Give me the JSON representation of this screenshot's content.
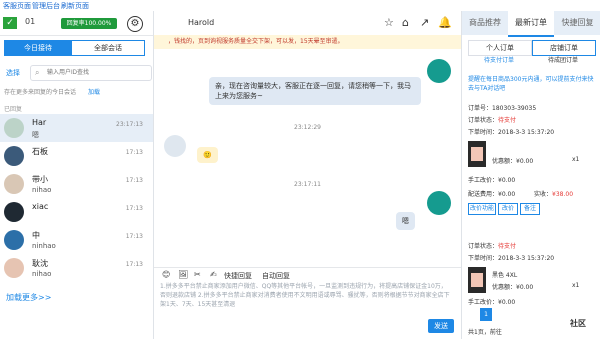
{
  "top_links": [
    "客服页面",
    "管理后台",
    "刷新页面"
  ],
  "left": {
    "status_icon": "check-icon",
    "account_label": "01",
    "online_label": "回复率100.00%",
    "tabs": [
      "今日接待",
      "全部会话"
    ],
    "filter_label": "选择",
    "search_placeholder": "输入用户ID查找",
    "hint_text": "存在更多来回复的今日会话",
    "load_link": "加载",
    "recent_label": "已回复",
    "conversations": [
      {
        "name": "Har",
        "msg": "嗯",
        "time": "23:17:13"
      },
      {
        "name": "石板",
        "msg": "",
        "time": "17:13"
      },
      {
        "name": "带小",
        "msg": "nihao",
        "time": "17:13"
      },
      {
        "name": "xiac",
        "msg": "",
        "time": "17:13"
      },
      {
        "name": "中",
        "msg": "ninhao",
        "time": "17:13"
      },
      {
        "name": "耿沈",
        "msg": "nihao",
        "time": "17:13"
      }
    ],
    "more_link": "加载更多>>"
  },
  "chat": {
    "title": "Harold",
    "header_icons": [
      "star-icon",
      "home-icon",
      "share-icon",
      "bell-icon"
    ],
    "notice": "，钱找的，页到询视服务质量全交下架，可以发，15天晕至审遣。",
    "messages": [
      {
        "side": "right",
        "text": "亲，现在咨询量较大，客服正在逐一回复，请您稍等一下，我马上来为您服务~"
      },
      {
        "time": "23:12:29"
      },
      {
        "side": "left",
        "text": "🙂"
      },
      {
        "time": "23:17:11"
      },
      {
        "side": "right",
        "text": "嗯"
      }
    ],
    "toolbar": [
      "😊",
      "🖼",
      "✂",
      "✍"
    ],
    "quick_reply": "快捷回复",
    "auto_reply": "自动回复",
    "input_text": "1.拼多多平台禁止商家添加用户微信、QQ等其他平台帐号，一旦监测到违规行为，将提高店铺保证金10万，否则退款店铺 2.拼多多平台禁止商家对消费者使用不文明用语或辱骂、骚扰等，否则将根据节节对商家全店下架1天、7天、15天甚至清退",
    "send_label": "发送"
  },
  "right": {
    "tabs": [
      "商品推荐",
      "最新订单",
      "快捷回复"
    ],
    "sub_tabs": [
      "个人订单",
      "店铺订单"
    ],
    "sub_sub": [
      "待支付订单",
      "待成团订单"
    ],
    "notice": "提醒在每日商品300元内通，可以提前支付来快去与TA对话吧",
    "orders": [
      {
        "order_no": "订单号：180303-39035",
        "status_label": "订单状态：",
        "status_value": "待支付",
        "time_label": "下单时间：",
        "time_value": "2018-3-3 15:37:20",
        "discount_label": "优惠额：",
        "discount_value": "¥0.00",
        "count": "x1",
        "manual_label": "手工改价：",
        "manual_value": "¥0.00",
        "ship_label": "配送费用：",
        "ship_value": "¥0.00",
        "paid_label": "实收：",
        "paid_value": "¥38.00",
        "buttons": [
          "改价功能",
          "改价",
          "备注"
        ]
      },
      {
        "status_label": "订单状态：",
        "status_value": "待支付",
        "time_label": "下单时间：",
        "time_value": "2018-3-3 15:37:20",
        "spec": "黑色 4XL",
        "discount_label": "优惠额：",
        "discount_value": "¥0.00",
        "count": "x1",
        "manual_label": "手工改价：",
        "manual_value": "¥0.00"
      }
    ],
    "page_current": "1",
    "page_text": "共1页，前往",
    "social": "社区"
  },
  "colors": {
    "accent": "#1e88e5",
    "online": "#1f9a3b",
    "notice_bg": "#fff6da",
    "notice_text": "#c0392b",
    "price_red": "#e53935"
  }
}
